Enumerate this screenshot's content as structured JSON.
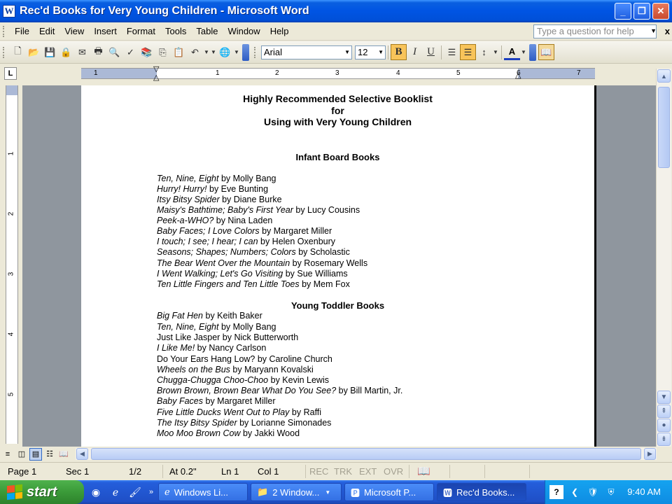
{
  "window": {
    "title": "Rec'd Books for Very Young Children - Microsoft Word",
    "minimize": "_",
    "restore": "❐",
    "close": "✕"
  },
  "menubar": {
    "items": [
      "File",
      "Edit",
      "View",
      "Insert",
      "Format",
      "Tools",
      "Table",
      "Window",
      "Help"
    ],
    "help_placeholder": "Type a question for help",
    "close": "x"
  },
  "toolbar": {
    "font_name": "Arial",
    "font_size": "12",
    "bold": "B",
    "italic": "I",
    "underline": "U",
    "font_color_label": "A"
  },
  "ruler": {
    "corner": "L",
    "numbers": [
      "1",
      "1",
      "2",
      "3",
      "4",
      "5",
      "6",
      "7"
    ],
    "vertical_numbers": [
      "1",
      "2",
      "3",
      "4",
      "5"
    ]
  },
  "document": {
    "title_lines": [
      "Highly Recommended Selective Booklist",
      "for",
      "Using with Very Young Children"
    ],
    "sections": [
      {
        "heading": "Infant Board Books",
        "books": [
          {
            "title": "Ten, Nine, Eight",
            "author": " by Molly Bang"
          },
          {
            "title": "Hurry! Hurry!",
            "author": " by Eve Bunting"
          },
          {
            "title": "Itsy Bitsy Spider",
            "author": " by Diane Burke"
          },
          {
            "title": "Maisy's Bathtime; Baby's First Year",
            "author": " by Lucy Cousins"
          },
          {
            "title": "Peek-a-WHO?",
            "author": " by Nina Laden"
          },
          {
            "title": "Baby Faces; I Love Colors",
            "author": " by Margaret Miller"
          },
          {
            "title": "I touch; I see; I hear; I can",
            "author": " by Helen Oxenbury"
          },
          {
            "title": "Seasons; Shapes; Numbers; Colors",
            "author": " by Scholastic"
          },
          {
            "title": "The Bear Went Over the Mountain",
            "author": " by Rosemary Wells"
          },
          {
            "title": "I Went Walking; Let's Go Visiting",
            "author": " by Sue Williams"
          },
          {
            "title": "Ten Little Fingers and Ten Little Toes",
            "author": " by Mem Fox"
          }
        ]
      },
      {
        "heading": "Young Toddler Books",
        "books": [
          {
            "title": "Big Fat Hen",
            "author": " by Keith Baker"
          },
          {
            "title": "Ten, Nine, Eight",
            "author": " by Molly Bang"
          },
          {
            "title": "",
            "author": "Just Like Jasper by Nick Butterworth"
          },
          {
            "title": "I Like Me!",
            "author": " by Nancy Carlson"
          },
          {
            "title": "",
            "author": "Do Your Ears Hang Low? by Caroline Church"
          },
          {
            "title": "Wheels on the Bus",
            "author": " by Maryann Kovalski"
          },
          {
            "title": "Chugga-Chugga Choo-Choo",
            "author": " by Kevin Lewis"
          },
          {
            "title": "Brown Brown, Brown Bear What Do You See?",
            "author": " by Bill Martin, Jr."
          },
          {
            "title": "Baby Faces",
            "author": " by Margaret Miller"
          },
          {
            "title": "Five Little Ducks Went Out to Play",
            "author": " by Raffi"
          },
          {
            "title": "The Itsy Bitsy Spider",
            "author": " by Lorianne Simonades"
          },
          {
            "title": "Moo Moo Brown Cow",
            "author": " by Jakki Wood"
          }
        ]
      }
    ]
  },
  "status": {
    "page": "Page  1",
    "sec": "Sec  1",
    "pages": "1/2",
    "at": "At  0.2\"",
    "ln": "Ln  1",
    "col": "Col  1",
    "rec": "REC",
    "trk": "TRK",
    "ext": "EXT",
    "ovr": "OVR"
  },
  "taskbar": {
    "start": "start",
    "tasks": [
      "Windows Li...",
      "2 Window...",
      "Microsoft P...",
      "Rec'd Books..."
    ],
    "clock": "9:40 AM"
  }
}
